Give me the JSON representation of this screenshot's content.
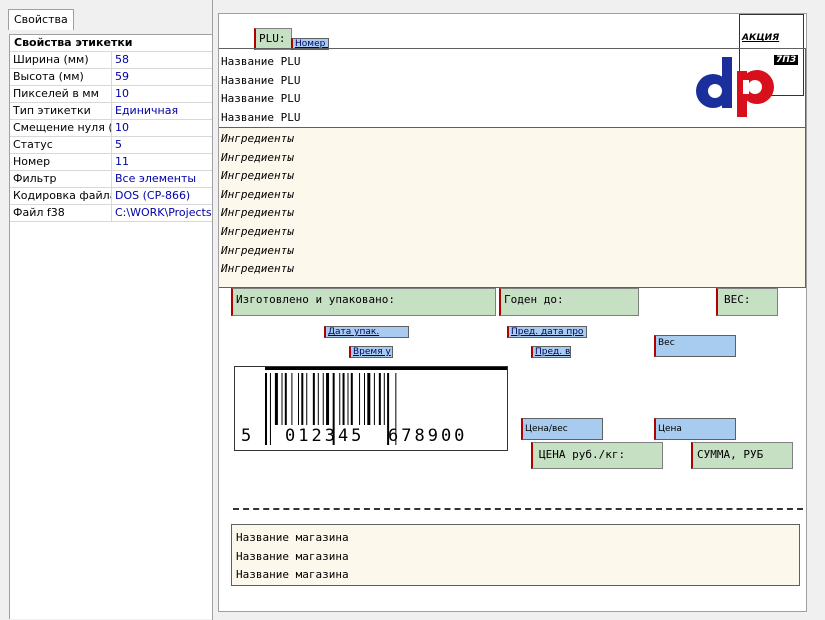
{
  "panel": {
    "tab_label": "Свойства",
    "section_title": "Свойства этикетки",
    "properties": [
      {
        "key": "Ширина (мм)",
        "value": "58"
      },
      {
        "key": "Высота (мм)",
        "value": "59"
      },
      {
        "key": "Пикселей в мм",
        "value": "10"
      },
      {
        "key": "Тип этикетки",
        "value": "Единичная"
      },
      {
        "key": "Смещение нуля (м",
        "value": "10"
      },
      {
        "key": "Статус",
        "value": "5"
      },
      {
        "key": "Номер",
        "value": "11"
      },
      {
        "key": "Фильтр",
        "value": "Все элементы"
      },
      {
        "key": "Кодировка файла",
        "value": "DOS (CP-866)"
      },
      {
        "key": "Файл f38",
        "value": "C:\\WORK\\Projects"
      }
    ]
  },
  "label": {
    "plu_text": "PLU:",
    "plu_number_field": "Номер Б",
    "logo_box_text": "АКЦИЯ",
    "logo_box_text2": "7ПЗ",
    "logo_text": "dP",
    "plu_names": [
      "Название PLU",
      "Название PLU",
      "Название PLU",
      "Название PLU"
    ],
    "ingredients": [
      "Ингредиенты",
      "Ингредиенты",
      "Ингредиенты",
      "Ингредиенты",
      "Ингредиенты",
      "Ингредиенты",
      "Ингредиенты",
      "Ингредиенты"
    ],
    "made_packed": "Изготовлено и упаковано:",
    "best_before": "Годен до:",
    "weight_caption": "ВЕС:",
    "pack_date_field": "Дата упак.",
    "pack_time_field": "Время у",
    "exp_date_field": "Пред. дата про",
    "exp_time_field": "Пред. в",
    "weight_field": "Вес",
    "barcode_digits": {
      "first": "5",
      "left": "012345",
      "right": "678900"
    },
    "price_per_weight_field": "Цена/вес",
    "price_field": "Цена",
    "price_caption": "ЦЕНА руб./кг:",
    "sum_caption": "СУММА, РУБ",
    "shop_names": [
      "Название магазина",
      "Название магазина",
      "Название магазина"
    ]
  },
  "colors": {
    "green_field": "#c6e0c4",
    "blue_field": "#a8ccf0",
    "cream_box": "#fdf8ec",
    "logo_blue": "#1a2f9c",
    "logo_red": "#d8101c"
  }
}
